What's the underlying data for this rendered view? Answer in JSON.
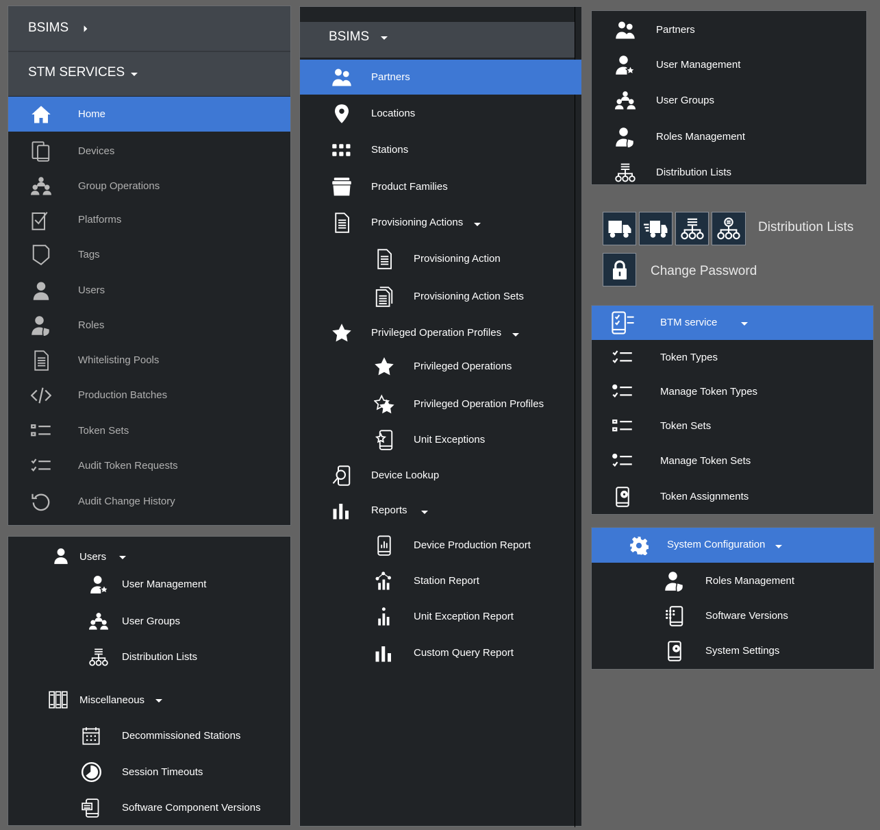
{
  "colors": {
    "accent": "#3e78d4",
    "panel": "#202326",
    "header": "#41464c",
    "background": "#636363"
  },
  "left_nav": {
    "app_title": "BSIMS",
    "section_title": "STM SERVICES",
    "items": [
      {
        "label": "Home",
        "icon": "home-icon",
        "active": true
      },
      {
        "label": "Devices",
        "icon": "devices-icon"
      },
      {
        "label": "Group Operations",
        "icon": "group-icon"
      },
      {
        "label": "Platforms",
        "icon": "platforms-icon"
      },
      {
        "label": "Tags",
        "icon": "tag-icon"
      },
      {
        "label": "Users",
        "icon": "user-icon"
      },
      {
        "label": "Roles",
        "icon": "roles-icon"
      },
      {
        "label": "Whitelisting Pools",
        "icon": "document-icon"
      },
      {
        "label": "Production Batches",
        "icon": "code-icon"
      },
      {
        "label": "Token Sets",
        "icon": "list-icon"
      },
      {
        "label": "Audit Token Requests",
        "icon": "checklist-icon"
      },
      {
        "label": "Audit Change History",
        "icon": "history-icon"
      }
    ]
  },
  "users_panel": {
    "users": {
      "label": "Users",
      "children": [
        "User Management",
        "User Groups",
        "Distribution Lists"
      ]
    },
    "misc": {
      "label": "Miscellaneous",
      "children": [
        "Decommissioned Stations",
        "Session Timeouts",
        "Software Component Versions"
      ]
    }
  },
  "middle_nav": {
    "app_title": "BSIMS",
    "items": [
      {
        "label": "Partners",
        "icon": "partners-icon",
        "active": true
      },
      {
        "label": "Locations",
        "icon": "location-pin-icon"
      },
      {
        "label": "Stations",
        "icon": "stations-grid-icon"
      },
      {
        "label": "Product Families",
        "icon": "product-box-icon"
      },
      {
        "label": "Provisioning Actions",
        "icon": "document-icon",
        "expanded": true
      },
      {
        "label": "Provisioning Action",
        "icon": "document-icon",
        "sub": true
      },
      {
        "label": "Provisioning Action Sets",
        "icon": "documents-icon",
        "sub": true
      },
      {
        "label": "Privileged Operation Profiles",
        "icon": "star-icon",
        "expanded": true
      },
      {
        "label": "Privileged Operations",
        "icon": "star-icon",
        "sub": true
      },
      {
        "label": "Privileged Operation Profiles",
        "icon": "stars-icon",
        "sub": true
      },
      {
        "label": "Unit Exceptions",
        "icon": "phone-star-icon",
        "sub": true
      },
      {
        "label": "Device Lookup",
        "icon": "device-search-icon"
      },
      {
        "label": "Reports",
        "icon": "bar-chart-icon",
        "expanded": true
      },
      {
        "label": "Device Production Report",
        "icon": "phone-chart-icon",
        "sub": true
      },
      {
        "label": "Station Report",
        "icon": "station-chart-icon",
        "sub": true
      },
      {
        "label": "Unit Exception Report",
        "icon": "small-chart-icon",
        "sub": true
      },
      {
        "label": "Custom Query Report",
        "icon": "bar-chart-icon",
        "sub": true
      }
    ]
  },
  "partners_panel": {
    "items": [
      {
        "label": "Partners",
        "icon": "partners-icon"
      },
      {
        "label": "User Management",
        "icon": "user-star-icon"
      },
      {
        "label": "User Groups",
        "icon": "user-groups-icon"
      },
      {
        "label": "Roles Management",
        "icon": "roles-icon"
      },
      {
        "label": "Distribution Lists",
        "icon": "distribution-icon"
      }
    ]
  },
  "icon_strip": {
    "icons": [
      "truck-icon",
      "truck-fast-icon",
      "distribution-icon",
      "distribution-list-icon"
    ],
    "label": "Distribution Lists",
    "password_label": "Change Password",
    "password_icon": "lock-icon"
  },
  "btm_panel": {
    "header": "BTM service",
    "items": [
      {
        "label": "Token Types",
        "icon": "checklist-icon"
      },
      {
        "label": "Manage Token Types",
        "icon": "gear-checklist-icon"
      },
      {
        "label": "Token Sets",
        "icon": "list-icon"
      },
      {
        "label": "Manage Token Sets",
        "icon": "gear-list-icon"
      },
      {
        "label": "Token Assignments",
        "icon": "phone-gear-icon"
      }
    ]
  },
  "sys_panel": {
    "header": "System Configuration",
    "items": [
      {
        "label": "Roles Management",
        "icon": "roles-icon"
      },
      {
        "label": "Software Versions",
        "icon": "phone-grid-icon"
      },
      {
        "label": "System Settings",
        "icon": "phone-gear-icon"
      }
    ]
  }
}
